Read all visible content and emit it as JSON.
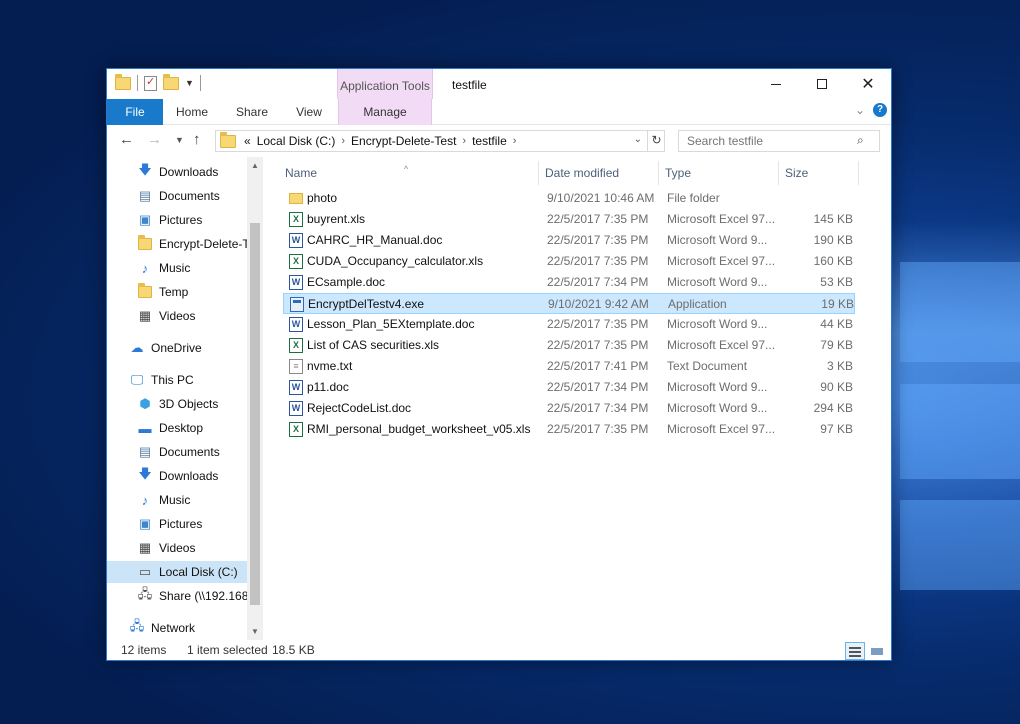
{
  "window": {
    "title": "testfile",
    "context_tab_group": "Application Tools"
  },
  "ribbon": {
    "tabs": [
      "File",
      "Home",
      "Share",
      "View",
      "Manage"
    ]
  },
  "address": {
    "overflow": "«",
    "crumbs": [
      "Local Disk (C:)",
      "Encrypt-Delete-Test",
      "testfile"
    ],
    "search_placeholder": "Search testfile"
  },
  "sidebar": {
    "quick_access": [
      {
        "label": "Downloads",
        "icon": "download-arrow-icon",
        "pinned": true
      },
      {
        "label": "Documents",
        "icon": "documents-icon",
        "pinned": true
      },
      {
        "label": "Pictures",
        "icon": "pictures-icon",
        "pinned": true
      },
      {
        "label": "Encrypt-Delete-T",
        "icon": "folder-icon",
        "pinned": false
      },
      {
        "label": "Music",
        "icon": "music-note-icon",
        "pinned": false
      },
      {
        "label": "Temp",
        "icon": "folder-icon",
        "pinned": false
      },
      {
        "label": "Videos",
        "icon": "videos-icon",
        "pinned": false
      }
    ],
    "onedrive": "OneDrive",
    "this_pc": "This PC",
    "pc_items": [
      {
        "label": "3D Objects",
        "icon": "3d-objects-icon"
      },
      {
        "label": "Desktop",
        "icon": "desktop-icon"
      },
      {
        "label": "Documents",
        "icon": "documents-icon"
      },
      {
        "label": "Downloads",
        "icon": "download-arrow-icon"
      },
      {
        "label": "Music",
        "icon": "music-note-icon"
      },
      {
        "label": "Pictures",
        "icon": "pictures-icon"
      },
      {
        "label": "Videos",
        "icon": "videos-icon"
      },
      {
        "label": "Local Disk (C:)",
        "icon": "drive-icon"
      },
      {
        "label": "Share (\\\\192.168",
        "icon": "network-drive-icon"
      }
    ],
    "network": "Network"
  },
  "columns": [
    "Name",
    "Date modified",
    "Type",
    "Size"
  ],
  "files": [
    {
      "name": "photo",
      "date": "9/10/2021 10:46 AM",
      "type": "File folder",
      "size": "",
      "kind": "folder"
    },
    {
      "name": "buyrent.xls",
      "date": "22/5/2017 7:35 PM",
      "type": "Microsoft Excel 97...",
      "size": "145 KB",
      "kind": "xls"
    },
    {
      "name": "CAHRC_HR_Manual.doc",
      "date": "22/5/2017 7:35 PM",
      "type": "Microsoft Word 9...",
      "size": "190 KB",
      "kind": "doc"
    },
    {
      "name": "CUDA_Occupancy_calculator.xls",
      "date": "22/5/2017 7:35 PM",
      "type": "Microsoft Excel 97...",
      "size": "160 KB",
      "kind": "xls"
    },
    {
      "name": "ECsample.doc",
      "date": "22/5/2017 7:34 PM",
      "type": "Microsoft Word 9...",
      "size": "53 KB",
      "kind": "doc"
    },
    {
      "name": "EncryptDelTestv4.exe",
      "date": "9/10/2021 9:42 AM",
      "type": "Application",
      "size": "19 KB",
      "kind": "exe",
      "selected": true
    },
    {
      "name": "Lesson_Plan_5EXtemplate.doc",
      "date": "22/5/2017 7:35 PM",
      "type": "Microsoft Word 9...",
      "size": "44 KB",
      "kind": "doc"
    },
    {
      "name": "List of CAS securities.xls",
      "date": "22/5/2017 7:35 PM",
      "type": "Microsoft Excel 97...",
      "size": "79 KB",
      "kind": "xls"
    },
    {
      "name": "nvme.txt",
      "date": "22/5/2017 7:41 PM",
      "type": "Text Document",
      "size": "3 KB",
      "kind": "txt"
    },
    {
      "name": "p11.doc",
      "date": "22/5/2017 7:34 PM",
      "type": "Microsoft Word 9...",
      "size": "90 KB",
      "kind": "doc"
    },
    {
      "name": "RejectCodeList.doc",
      "date": "22/5/2017 7:34 PM",
      "type": "Microsoft Word 9...",
      "size": "294 KB",
      "kind": "doc"
    },
    {
      "name": "RMI_personal_budget_worksheet_v05.xls",
      "date": "22/5/2017 7:35 PM",
      "type": "Microsoft Excel 97...",
      "size": "97 KB",
      "kind": "xls"
    }
  ],
  "status": {
    "count": "12 items",
    "selection": "1 item selected",
    "selection_size": "18.5 KB"
  },
  "colors": {
    "accent": "#1979ca",
    "context_tab": "#f2dcf5",
    "selection": "#cce8ff"
  }
}
